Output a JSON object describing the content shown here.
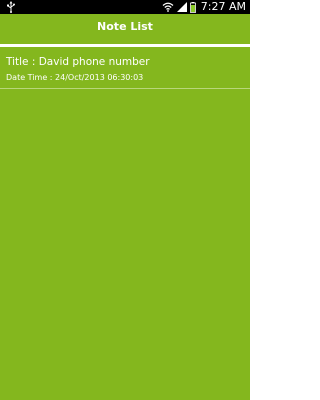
{
  "status_bar": {
    "time": "7:27 AM",
    "icons": [
      "usb-icon",
      "wifi-icon",
      "signal-icon",
      "battery-icon"
    ]
  },
  "header": {
    "title": "Note List"
  },
  "notes": [
    {
      "title": "Title : David phone number",
      "datetime": "Date Time : 24/Oct/2013 06:30:03"
    }
  ],
  "colors": {
    "background": "#84b71e",
    "status_bar": "#000000",
    "text": "#ffffff",
    "divider": "#b9d77a"
  }
}
